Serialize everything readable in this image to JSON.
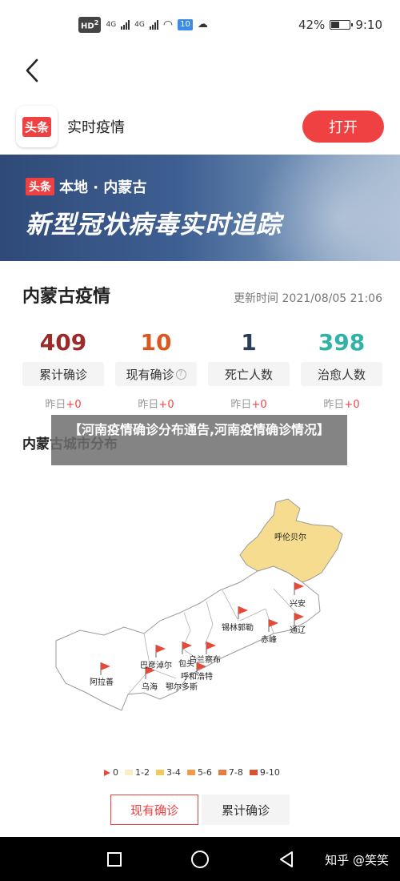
{
  "status_bar": {
    "net1": "HD",
    "net1_sub": "2",
    "sig1": "4G",
    "sig2": "4G",
    "wifi_chip": "10",
    "battery": "42%",
    "time": "9:10"
  },
  "header": {
    "back_icon": "chevron-left-icon",
    "app_logo_text": "头条",
    "app_name": "实时疫情",
    "open_label": "打开"
  },
  "banner": {
    "tag_logo": "头条",
    "tag_text": "本地 · 内蒙古",
    "title": "新型冠状病毒实时追踪"
  },
  "stats": {
    "title": "内蒙古疫情",
    "update": "更新时间 2021/08/05 21:06",
    "items": [
      {
        "num": "409",
        "label": "累计确诊",
        "delta_prefix": "昨日",
        "delta": "+0",
        "color": "#9b2a2a"
      },
      {
        "num": "10",
        "label": "现有确诊",
        "delta_prefix": "昨日",
        "delta": "+0",
        "color": "#d9581f"
      },
      {
        "num": "1",
        "label": "死亡人数",
        "delta_prefix": "昨日",
        "delta": "+0",
        "color": "#2a3d5a"
      },
      {
        "num": "398",
        "label": "治愈人数",
        "delta_prefix": "昨日",
        "delta": "+0",
        "color": "#2fb3a8"
      }
    ],
    "help_icon": "question-icon"
  },
  "city": {
    "title": "内蒙古城市分布",
    "overlay": "【河南疫情确诊分布通告,河南疫情确诊情况】"
  },
  "map": {
    "labels": [
      "呼伦贝尔",
      "兴安",
      "锡林郭勒",
      "赤峰",
      "通辽",
      "乌兰察布",
      "巴彦淖尔",
      "包头",
      "呼和浩特",
      "阿拉善",
      "乌海",
      "鄂尔多斯"
    ],
    "highlight_color": "#f6dc8e",
    "base_color": "#ffffff",
    "flag_color": "#e34a3a"
  },
  "legend": [
    {
      "label": "0",
      "color": "#e34a3a",
      "kind": "flag"
    },
    {
      "label": "1-2",
      "color": "#fbedc2",
      "kind": "swatch"
    },
    {
      "label": "3-4",
      "color": "#f4c85a",
      "kind": "swatch"
    },
    {
      "label": "5-6",
      "color": "#f19a4b",
      "kind": "swatch"
    },
    {
      "label": "7-8",
      "color": "#e87a3e",
      "kind": "swatch"
    },
    {
      "label": "9-10",
      "color": "#d9522e",
      "kind": "swatch"
    }
  ],
  "tabs": {
    "active": "现有确诊",
    "inactive": "累计确诊"
  },
  "navbar": {
    "icons": [
      "square-icon",
      "circle-icon",
      "triangle-back-icon"
    ],
    "watermark": "知乎 @笑笑"
  }
}
